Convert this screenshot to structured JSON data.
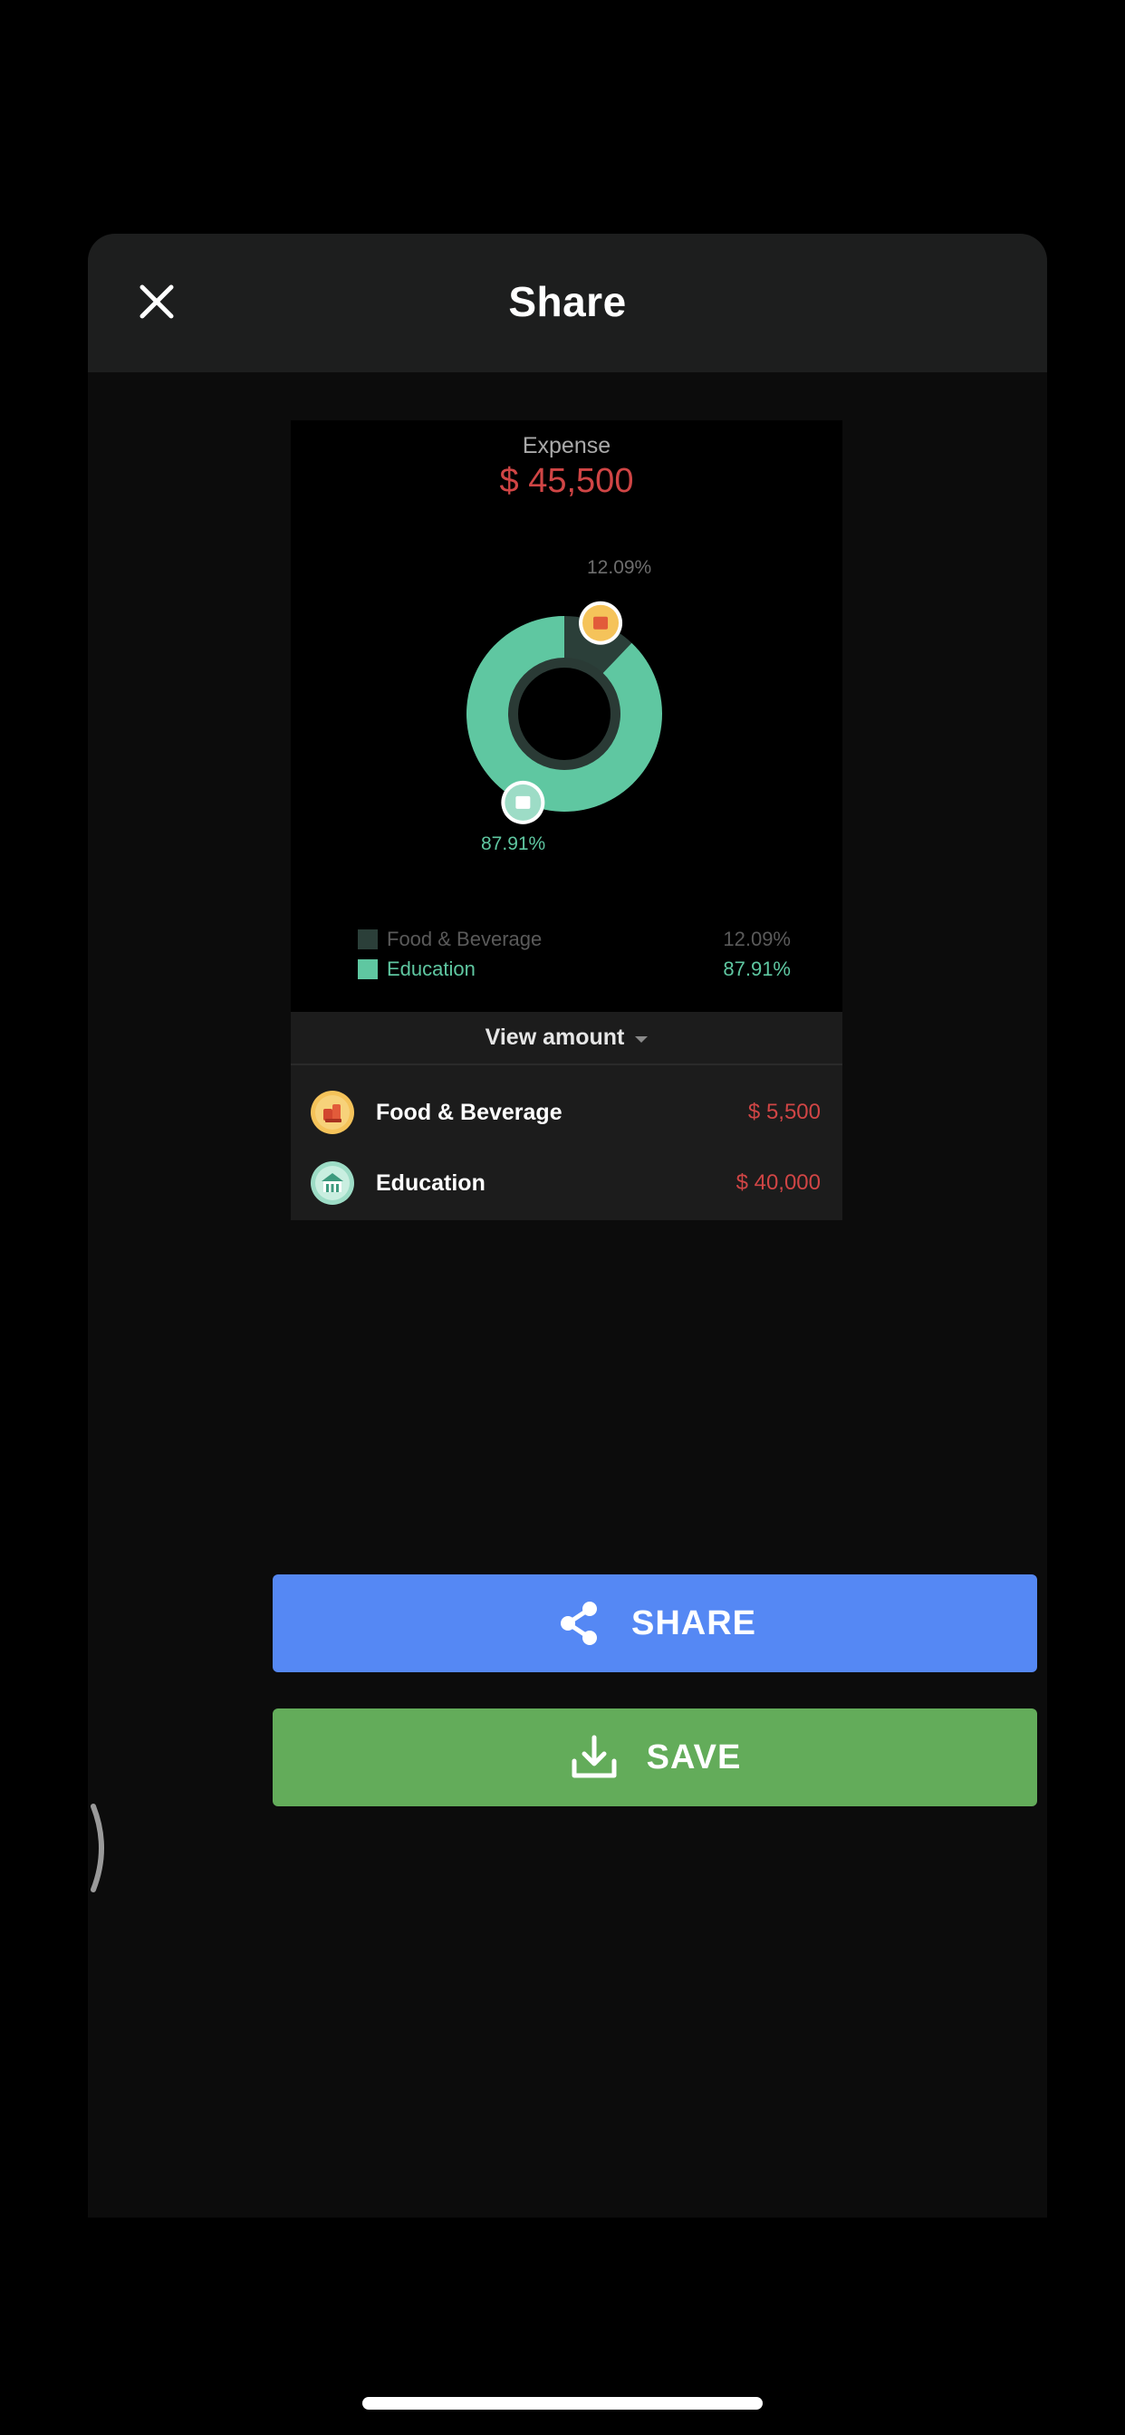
{
  "header": {
    "title": "Share",
    "close_icon": "close-icon"
  },
  "preview": {
    "label": "Expense",
    "total": "$ 45,500",
    "chart_data": {
      "type": "pie",
      "title": "Expense",
      "categories": [
        "Food & Beverage",
        "Education"
      ],
      "values": [
        12.09,
        87.91
      ],
      "labels": [
        "12.09%",
        "87.91%"
      ],
      "colors": [
        "#2b3f39",
        "#5fc7a1"
      ],
      "style": "donut",
      "legend": "bottom"
    },
    "legend": [
      {
        "name": "Food & Beverage",
        "pct": "12.09%",
        "color": "#2b3f39"
      },
      {
        "name": "Education",
        "pct": "87.91%",
        "color": "#5fc7a1"
      }
    ]
  },
  "amounts": {
    "toggle_label": "View amount",
    "rows": [
      {
        "name": "Food & Beverage",
        "amount": "$ 5,500",
        "icon": "food-beverage-icon"
      },
      {
        "name": "Education",
        "amount": "$ 40,000",
        "icon": "education-icon"
      }
    ]
  },
  "actions": {
    "share_label": "SHARE",
    "save_label": "SAVE",
    "share_color": "#5588f4",
    "save_color": "#63ac5a"
  },
  "colors": {
    "expense_red": "#d04545",
    "accent_green": "#5fc7a1",
    "sheet_bg": "#0c0c0c",
    "header_bg": "#1d1e1e"
  }
}
